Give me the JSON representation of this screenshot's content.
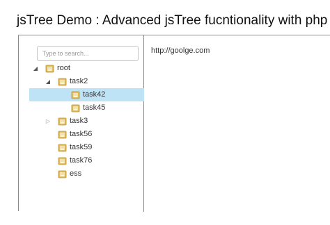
{
  "page": {
    "title": "jsTree Demo : Advanced jsTree fucntionality with php"
  },
  "search": {
    "placeholder": "Type to search..."
  },
  "tree": {
    "nodes": [
      {
        "label": "root",
        "toggle": "expanded"
      },
      {
        "label": "task2",
        "toggle": "expanded"
      },
      {
        "label": "task42",
        "toggle": "none",
        "selected": true
      },
      {
        "label": "task45",
        "toggle": "none"
      },
      {
        "label": "task3",
        "toggle": "collapsed"
      },
      {
        "label": "task56",
        "toggle": "none"
      },
      {
        "label": "task59",
        "toggle": "none"
      },
      {
        "label": "task76",
        "toggle": "none"
      },
      {
        "label": "ess",
        "toggle": "none"
      }
    ]
  },
  "content": {
    "text": "http://goolge.com"
  },
  "colors": {
    "selection": "#bfe3f6",
    "folder": "#e8c25f"
  },
  "icons": {
    "expanded": "triangle-down-icon",
    "collapsed": "triangle-right-icon",
    "node": "folder-icon"
  }
}
